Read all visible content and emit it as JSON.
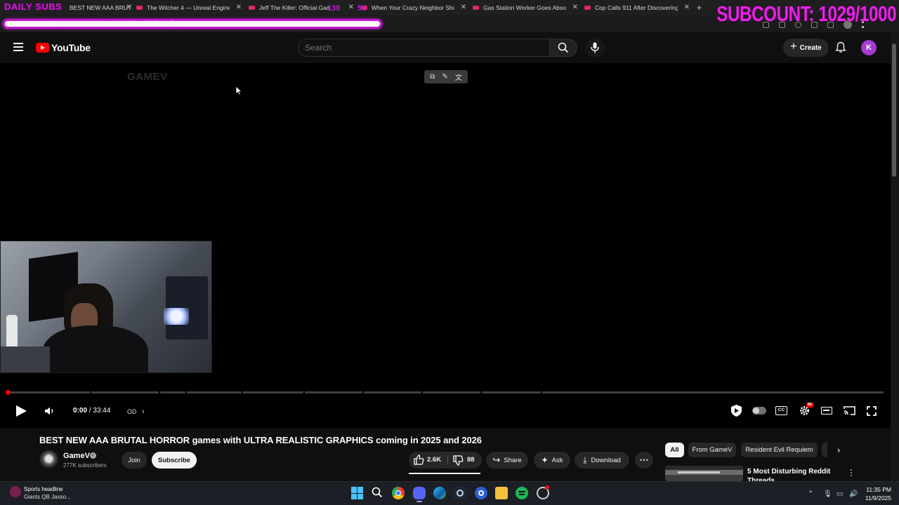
{
  "overlay": {
    "daily_subs": "DAILY SUBS",
    "subcount": "SUBCOUNT: 1029/1000",
    "tag_left": "130",
    "tag_right": "50"
  },
  "browser": {
    "tabs": [
      {
        "title": "BEST NEW AAA BRUTAL HORROR"
      },
      {
        "title": "The Witcher 4 — Unreal Engine 5"
      },
      {
        "title": "Jeff The Killer: Official Game"
      },
      {
        "title": "When Your Crazy Neighbor Shoots"
      },
      {
        "title": "Gas Station Worker Goes Absolut"
      },
      {
        "title": "Cop Calls 911 After Discovering S"
      }
    ],
    "new_tab": "+",
    "url": "https://www.youtube.com/watch?v=_rCl-Z-MhdEg"
  },
  "youtube": {
    "logo_text": "YouTube",
    "search_placeholder": "Search",
    "create_label": "Create",
    "avatar_letter": "K"
  },
  "player": {
    "watermark": "GAMEV",
    "current_time": "0:00",
    "duration": "33:44",
    "time_separator": " / ",
    "chapter_label": "OD",
    "progress": 0.0,
    "toolbar_icons": [
      "picture-in-picture-icon",
      "notes-icon",
      "translate-icon"
    ],
    "ext_badge": "4K"
  },
  "video": {
    "title": "BEST NEW AAA BRUTAL HORROR games with ULTRA REALISTIC GRAPHICS coming in 2025 and 2026",
    "channel": "GameV",
    "subscribers": "277K subscribers",
    "join_label": "Join",
    "subscribe_label": "Subscribe",
    "likes": "2.6K",
    "dislikes": "88",
    "share_label": "Share",
    "ask_label": "Ask",
    "download_label": "Download"
  },
  "sidebar": {
    "chips": [
      "All",
      "From GameV",
      "Resident Evil Requiem"
    ],
    "recommendation_title": "5 Most Disturbing Reddit Threads"
  },
  "taskbar": {
    "news_headline": "Sports headline",
    "news_sub": "Giants QB Jaxso...",
    "time": "11:35 PM",
    "date": "11/9/2025"
  },
  "colors": {
    "overlay_magenta": "#e622e6",
    "youtube_red": "#ff0000",
    "background": "#0f0f0f"
  }
}
